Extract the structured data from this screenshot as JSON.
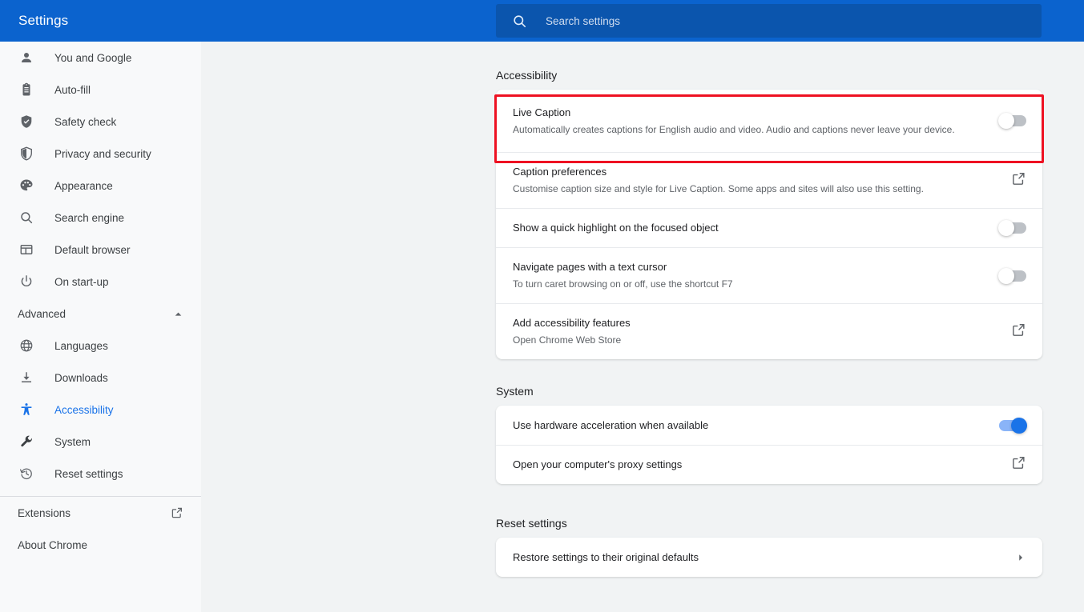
{
  "header": {
    "title": "Settings",
    "search": {
      "placeholder": "Search settings",
      "value": "",
      "icon": "search-icon"
    },
    "background_color": "#0b63ce"
  },
  "sidebar": {
    "items": [
      {
        "label": "You and Google",
        "icon": "person-icon",
        "active": false
      },
      {
        "label": "Auto-fill",
        "icon": "clipboard-icon",
        "active": false
      },
      {
        "label": "Safety check",
        "icon": "shield-check-icon",
        "active": false
      },
      {
        "label": "Privacy and security",
        "icon": "shield-half-icon",
        "active": false
      },
      {
        "label": "Appearance",
        "icon": "palette-icon",
        "active": false
      },
      {
        "label": "Search engine",
        "icon": "search-icon",
        "active": false
      },
      {
        "label": "Default browser",
        "icon": "browser-window-icon",
        "active": false
      },
      {
        "label": "On start-up",
        "icon": "power-icon",
        "active": false
      }
    ],
    "advanced": {
      "label": "Advanced",
      "expanded": true,
      "caret_icon": "chevron-up-icon",
      "items": [
        {
          "label": "Languages",
          "icon": "globe-icon",
          "active": false
        },
        {
          "label": "Downloads",
          "icon": "download-icon",
          "active": false
        },
        {
          "label": "Accessibility",
          "icon": "accessibility-person-icon",
          "active": true
        },
        {
          "label": "System",
          "icon": "wrench-icon",
          "active": false
        },
        {
          "label": "Reset settings",
          "icon": "history-restore-icon",
          "active": false
        }
      ]
    },
    "footer": [
      {
        "label": "Extensions",
        "icon": "open-in-new-icon",
        "has_external_icon": true
      },
      {
        "label": "About Chrome",
        "icon": "",
        "has_external_icon": false
      }
    ],
    "active_color": "#1a73e8"
  },
  "main": {
    "sections": [
      {
        "title": "Accessibility",
        "rows": [
          {
            "title": "Live Caption",
            "subtitle": "Automatically creates captions for English audio and video. Audio and captions never leave your device.",
            "control": "toggle",
            "toggle_state": "off",
            "highlighted": true
          },
          {
            "title": "Caption preferences",
            "subtitle": "Customise caption size and style for Live Caption. Some apps and sites will also use this setting.",
            "control": "external-link",
            "toggle_state": "",
            "highlighted": false
          },
          {
            "title": "Show a quick highlight on the focused object",
            "subtitle": "",
            "control": "toggle",
            "toggle_state": "off",
            "highlighted": false
          },
          {
            "title": "Navigate pages with a text cursor",
            "subtitle": "To turn caret browsing on or off, use the shortcut F7",
            "control": "toggle",
            "toggle_state": "off",
            "highlighted": false
          },
          {
            "title": "Add accessibility features",
            "subtitle": "Open Chrome Web Store",
            "control": "external-link",
            "toggle_state": "",
            "highlighted": false
          }
        ]
      },
      {
        "title": "System",
        "rows": [
          {
            "title": "Use hardware acceleration when available",
            "subtitle": "",
            "control": "toggle",
            "toggle_state": "on",
            "highlighted": false
          },
          {
            "title": "Open your computer's proxy settings",
            "subtitle": "",
            "control": "external-link",
            "toggle_state": "",
            "highlighted": false
          }
        ]
      },
      {
        "title": "Reset settings",
        "rows": [
          {
            "title": "Restore settings to their original defaults",
            "subtitle": "",
            "control": "chevron-right",
            "toggle_state": "",
            "highlighted": false
          }
        ]
      }
    ],
    "highlight_color": "#ee1122",
    "background_color": "#f1f3f4"
  }
}
